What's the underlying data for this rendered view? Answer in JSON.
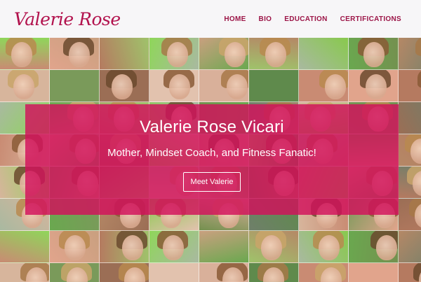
{
  "header": {
    "logo": "Valerie Rose",
    "nav": [
      {
        "label": "HOME"
      },
      {
        "label": "BIO"
      },
      {
        "label": "EDUCATION"
      },
      {
        "label": "CERTIFICATIONS"
      }
    ]
  },
  "hero": {
    "title": "Valerie Rose Vicari",
    "subtitle": "Mother, Mindset Coach, and Fitness Fanatic!",
    "button_label": "Meet Valerie"
  },
  "colors": {
    "brand": "#b2124d",
    "hero_overlay": "#d2105c",
    "header_bg": "#f7f6f8"
  },
  "mosaic": {
    "tile_palettes": [
      "#c98b73",
      "#7a9a5a",
      "#b58866",
      "#8fd65a",
      "#d9b09a",
      "#6f7f6a",
      "#a9b9a0",
      "#e1a48c",
      "#9b6e55",
      "#88c94d",
      "#c9a07f",
      "#5f8a4c",
      "#d7b59c",
      "#6aa84f",
      "#b57a60",
      "#e2c2ae",
      "#74904f",
      "#9fc36b"
    ]
  }
}
